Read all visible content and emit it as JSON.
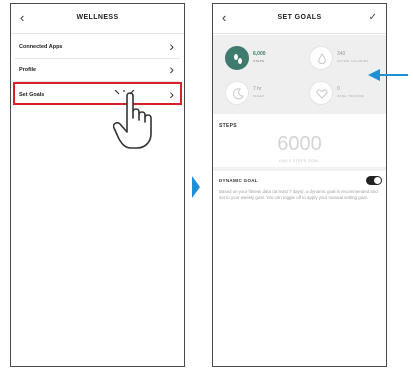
{
  "colors": {
    "highlight_red": "#d81f2a",
    "accent_green": "#3f7a6f",
    "pointer_blue": "#1f8fd6"
  },
  "left_screen": {
    "title": "WELLNESS",
    "back_icon": "chevron-left-icon",
    "menu": [
      {
        "label": "Connected Apps",
        "icon": "chevron-right-icon"
      },
      {
        "label": "Profile",
        "icon": "chevron-right-icon"
      },
      {
        "label": "Set Goals",
        "icon": "chevron-right-icon",
        "highlighted": true
      }
    ],
    "pointer_icon": "hand-pointer-icon"
  },
  "right_screen": {
    "title": "SET GOALS",
    "back_icon": "chevron-left-icon",
    "confirm_icon": "check-icon",
    "stats": [
      {
        "value": "6,000",
        "label": "STEPS",
        "icon": "steps-icon",
        "active": true
      },
      {
        "value": "340",
        "label": "ACTIVE CALORIES",
        "icon": "flame-icon",
        "active": false
      },
      {
        "value": "7 hr",
        "label": "SLEEP",
        "icon": "moon-icon",
        "active": false
      },
      {
        "value": "0",
        "label": "ZONE TRAINING",
        "icon": "heart-zone-icon",
        "active": false
      }
    ],
    "steps_section": {
      "title": "STEPS",
      "value": "6000",
      "label": "DAILY STEPS GOAL"
    },
    "dynamic_goal": {
      "title": "DYNAMIC GOAL",
      "enabled": true,
      "description": "Based on your fitness data (at least 7 days), a dynamic goal is recommended and set to your weekly goal. You can toggle off to apply your manual setting goal."
    }
  }
}
